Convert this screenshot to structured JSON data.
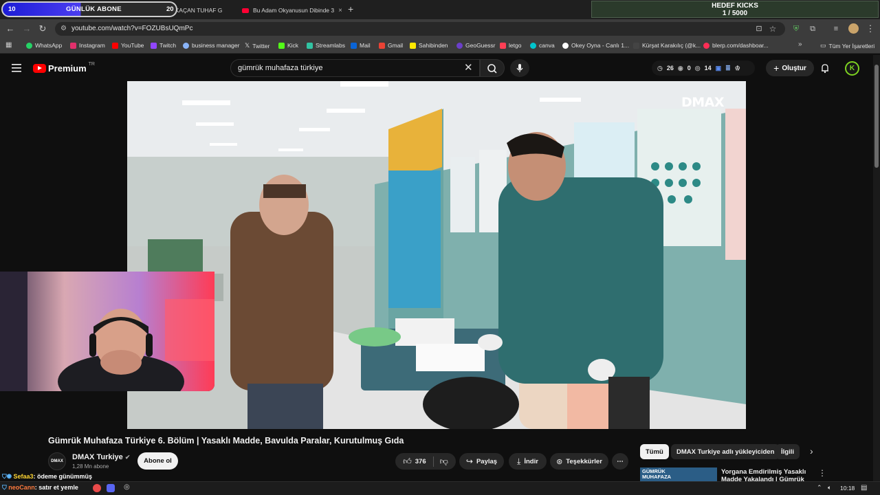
{
  "browser": {
    "tabs": [
      {
        "title": "ADANA'DA KAÇAN TUHAF G"
      },
      {
        "title": "Bu Adam Okyanusun Dibinde 3"
      }
    ],
    "url": "youtube.com/watch?v=FOZUBsUQmPc",
    "bookmarks": [
      {
        "label": "WhatsApp",
        "color": "#25d366"
      },
      {
        "label": "Instagram",
        "color": "#e1306c"
      },
      {
        "label": "YouTube",
        "color": "#ff0000"
      },
      {
        "label": "Twitch",
        "color": "#9146ff"
      },
      {
        "label": "business manager",
        "color": "#8ab4f8"
      },
      {
        "label": "Twitter",
        "color": "#111111"
      },
      {
        "label": "Kick",
        "color": "#53fc18"
      },
      {
        "label": "Streamlabs",
        "color": "#31c3a2"
      },
      {
        "label": "Mail",
        "color": "#0a64d6"
      },
      {
        "label": "Gmail",
        "color": "#ea4335"
      },
      {
        "label": "Sahibinden",
        "color": "#ffe800"
      },
      {
        "label": "GeoGuessr",
        "color": "#6b3fc9"
      },
      {
        "label": "letgo",
        "color": "#ff3f55"
      },
      {
        "label": "canva",
        "color": "#00c4cc"
      },
      {
        "label": "Okey Oyna - Canlı 1...",
        "color": "#ffffff"
      },
      {
        "label": "Kürşat Karakılıç (@k...",
        "color": "#444444"
      },
      {
        "label": "blerp.com/dashboar...",
        "color": "#ff2d55"
      }
    ],
    "all_bookmarks": "Tüm Yer İşaretleri"
  },
  "overlay": {
    "sub_goal": {
      "current": "10",
      "label": "GÜNLÜK ABONE",
      "target": "20"
    },
    "kicks_goal": {
      "label": "HEDEF KICKS",
      "progress": "1 / 5000"
    },
    "chat": [
      {
        "user": "Sefaa3",
        "message": ": ödeme günümmüş"
      },
      {
        "user": "neoCann",
        "message": ": satır et yemle"
      }
    ]
  },
  "youtube": {
    "logo_text": "Premium",
    "region": "TR",
    "search_query": "gümrük muhafaza türkiye",
    "stats": [
      "26",
      "0",
      "14"
    ],
    "create_label": "Oluştur",
    "avatar_letter": "K",
    "video": {
      "watermark": "DMAX",
      "title": "Gümrük Muhafaza Türkiye 6. Bölüm | Yasaklı Madde, Bavulda Paralar, Kurutulmuş Gıda",
      "channel": "DMAX Turkiye",
      "channel_avatar_text": "DMAX",
      "subscribers": "1,28 Mn abone",
      "subscribe_label": "Abone ol",
      "likes": "376",
      "share_label": "Paylaş",
      "download_label": "İndir",
      "thanks_label": "Teşekkürler"
    },
    "chips": [
      "Tümü",
      "DMAX Turkiye adlı yükleyiciden",
      "İlgili"
    ],
    "related": {
      "title": "Yorgana Emdirilmiş Yasaklı Madde Yakalandı | Gümrük",
      "thumb_text": "GÜMRÜK MUHAFAZA"
    }
  },
  "taskbar": {
    "time": "10:18"
  }
}
